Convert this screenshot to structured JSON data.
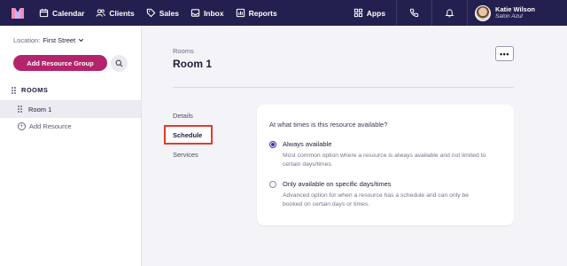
{
  "nav": {
    "items": [
      {
        "label": "Calendar",
        "icon": "calendar-icon"
      },
      {
        "label": "Clients",
        "icon": "users-icon"
      },
      {
        "label": "Sales",
        "icon": "tag-icon"
      },
      {
        "label": "Inbox",
        "icon": "inbox-icon"
      },
      {
        "label": "Reports",
        "icon": "chart-icon"
      }
    ],
    "apps_label": "Apps",
    "user": {
      "name": "Katie Wilson",
      "salon": "Salon Azul"
    },
    "colors": {
      "bar": "#231f4f"
    }
  },
  "sidebar": {
    "location_label": "Location:",
    "location_value": "First Street",
    "add_group_label": "Add Resource Group",
    "group_title": "ROOMS",
    "items": [
      {
        "label": "Room 1"
      }
    ],
    "add_resource_label": "Add Resource",
    "colors": {
      "primary": "#b3246d"
    }
  },
  "main": {
    "breadcrumb": "Rooms",
    "title": "Room 1",
    "more_label": "•••",
    "tabs": [
      {
        "label": "Details"
      },
      {
        "label": "Schedule",
        "selected": true
      },
      {
        "label": "Services"
      }
    ],
    "availability": {
      "question": "At what times is this resource available?",
      "options": [
        {
          "title": "Always available",
          "description": "Most common option where a resource is always available and not limited to certain days/times.",
          "checked": true
        },
        {
          "title": "Only available on specific days/times",
          "description": "Advanced option for when a resource has a schedule and can only be booked on certain days or times.",
          "checked": false
        }
      ]
    },
    "colors": {
      "highlight": "#e23b2e",
      "radio": "#3a2fa8"
    }
  }
}
